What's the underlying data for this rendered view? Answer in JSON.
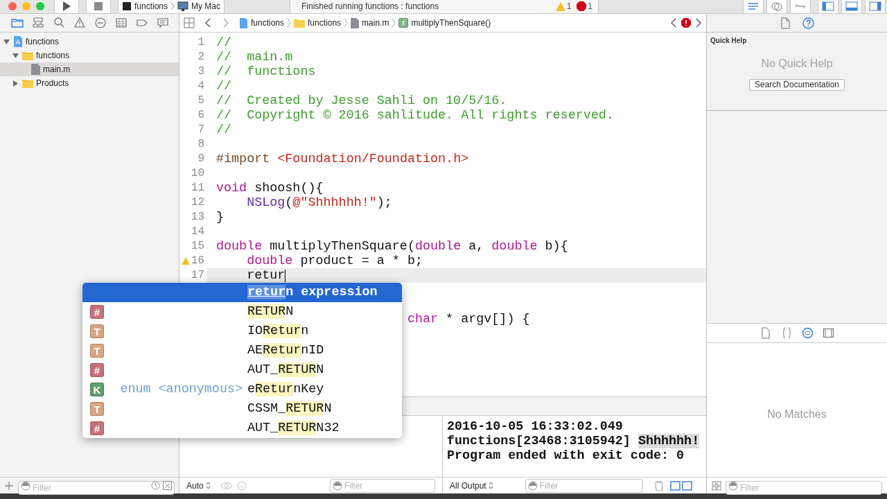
{
  "toolbar": {
    "scheme": "functions",
    "destination": "My Mac",
    "status": "Finished running functions : functions",
    "warning_count": "1",
    "error_count": "1"
  },
  "navigator": {
    "tabs": [
      {
        "selected": true
      },
      {
        "selected": false
      },
      {
        "selected": false
      },
      {
        "selected": false
      },
      {
        "selected": false
      },
      {
        "selected": false
      },
      {
        "selected": false
      },
      {
        "selected": false
      }
    ],
    "tree": [
      {
        "kind": "project",
        "label": "functions",
        "expanded": true,
        "selected": false,
        "children": [
          {
            "kind": "folder",
            "label": "functions",
            "expanded": true,
            "selected": false,
            "children": [
              {
                "kind": "file",
                "label": "main.m",
                "selected": true
              }
            ]
          },
          {
            "kind": "folder",
            "label": "Products",
            "expanded": false,
            "selected": false
          }
        ]
      }
    ],
    "filter": {
      "placeholder": "Filter"
    }
  },
  "jump_bar": {
    "crumbs": [
      {
        "kind": "project",
        "label": "functions"
      },
      {
        "kind": "folder",
        "label": "functions"
      },
      {
        "kind": "file",
        "label": "main.m"
      },
      {
        "kind": "function",
        "label": "multiplyThenSquare()"
      }
    ]
  },
  "editor": {
    "lines": [
      {
        "number": "1",
        "warning": false,
        "current": false,
        "tokens": [
          {
            "t": "//",
            "kind": "comment"
          }
        ]
      },
      {
        "number": "2",
        "warning": false,
        "current": false,
        "tokens": [
          {
            "t": "//  main.m",
            "kind": "comment"
          }
        ]
      },
      {
        "number": "3",
        "warning": false,
        "current": false,
        "tokens": [
          {
            "t": "//  functions",
            "kind": "comment"
          }
        ]
      },
      {
        "number": "4",
        "warning": false,
        "current": false,
        "tokens": [
          {
            "t": "//",
            "kind": "comment"
          }
        ]
      },
      {
        "number": "5",
        "warning": false,
        "current": false,
        "tokens": [
          {
            "t": "//  Created by Jesse Sahli on 10/5/16.",
            "kind": "comment"
          }
        ]
      },
      {
        "number": "6",
        "warning": false,
        "current": false,
        "tokens": [
          {
            "t": "//  Copyright © 2016 sahlitude. All rights reserved.",
            "kind": "comment"
          }
        ]
      },
      {
        "number": "7",
        "warning": false,
        "current": false,
        "tokens": [
          {
            "t": "//",
            "kind": "comment"
          }
        ]
      },
      {
        "number": "8",
        "warning": false,
        "current": false
      },
      {
        "number": "9",
        "warning": false,
        "current": false,
        "tokens": [
          {
            "t": "#import",
            "kind": "preprocessor"
          },
          {
            "t": " <Foundation/Foundation.h>",
            "kind": "string"
          }
        ]
      },
      {
        "number": "10",
        "warning": false,
        "current": false
      },
      {
        "number": "11",
        "warning": false,
        "current": false,
        "tokens": [
          {
            "t": "void",
            "kind": "keyword"
          },
          {
            "t": " shoosh(){",
            "kind": "plain"
          }
        ]
      },
      {
        "number": "12",
        "warning": false,
        "current": false,
        "tokens": [
          {
            "t": "    NSLog",
            "kind": "function"
          },
          {
            "t": "(",
            "kind": "plain"
          },
          {
            "t": "@\"Shhhhhh!\"",
            "kind": "string"
          },
          {
            "t": ");",
            "kind": "plain"
          }
        ]
      },
      {
        "number": "13",
        "warning": false,
        "current": false,
        "tokens": [
          {
            "t": "}",
            "kind": "plain"
          }
        ]
      },
      {
        "number": "14",
        "warning": false,
        "current": false
      },
      {
        "number": "15",
        "warning": false,
        "current": false,
        "tokens": [
          {
            "t": "double",
            "kind": "keyword"
          },
          {
            "t": " multiplyThenSquare(",
            "kind": "plain"
          },
          {
            "t": "double",
            "kind": "keyword"
          },
          {
            "t": " a, ",
            "kind": "plain"
          },
          {
            "t": "double",
            "kind": "keyword"
          },
          {
            "t": " b){",
            "kind": "plain"
          }
        ]
      },
      {
        "number": "16",
        "warning": true,
        "current": false,
        "tokens": [
          {
            "t": "    double",
            "kind": "keyword"
          },
          {
            "t": " product = a * b;",
            "kind": "plain"
          }
        ]
      },
      {
        "number": "17",
        "warning": false,
        "current": true,
        "tokens": [
          {
            "t": "    retur",
            "kind": "plain"
          }
        ]
      },
      {
        "warning": false,
        "current": false
      },
      {
        "warning": false,
        "current": false
      },
      {
        "warning": false,
        "current": false,
        "tokens": [
          {
            "t": "                         char",
            "kind": "keyword"
          },
          {
            "t": " * argv[]) {",
            "kind": "plain"
          }
        ]
      }
    ]
  },
  "completion": {
    "items": [
      {
        "selected": true,
        "match": "retur",
        "suffix": "n expression"
      },
      {
        "selected": false,
        "badge": "#",
        "color": "#c8707b",
        "match": "RETUR",
        "suffix": "N"
      },
      {
        "selected": false,
        "badge": "T",
        "color": "#d8a682",
        "prefix": "IO",
        "match": "Retur",
        "suffix": "n"
      },
      {
        "selected": false,
        "badge": "T",
        "color": "#d8a682",
        "prefix": "AE",
        "match": "Retur",
        "suffix": "nID"
      },
      {
        "selected": false,
        "badge": "#",
        "color": "#c8707b",
        "prefix": "AUT_",
        "match": "RETUR",
        "suffix": "N"
      },
      {
        "selected": false,
        "badge": "K",
        "color": "#5f9f69",
        "type": "enum <anonymous>",
        "prefix": "e",
        "match": "Retur",
        "suffix": "nKey"
      },
      {
        "selected": false,
        "badge": "T",
        "color": "#d8a682",
        "prefix": "CSSM_",
        "match": "RETUR",
        "suffix": "N"
      },
      {
        "selected": false,
        "badge": "#",
        "color": "#c8707b",
        "prefix": "AUT_",
        "match": "RETUR",
        "suffix": "N32"
      }
    ]
  },
  "debug": {
    "variables_scope": "Auto",
    "variables_filter": {
      "placeholder": "Filter"
    },
    "console": [
      {
        "segments": [
          {
            "text": "2016-10-05 16:33:02.049",
            "highlight": false
          }
        ]
      },
      {
        "segments": [
          {
            "text": "functions[23468:3105942] ",
            "highlight": false
          },
          {
            "text": "Shhhhhh!",
            "highlight": true
          }
        ]
      },
      {
        "segments": [
          {
            "text": "Program ended with exit code: 0",
            "highlight": false
          }
        ]
      }
    ],
    "output_mode": "All Output",
    "console_filter": {
      "placeholder": "Filter"
    }
  },
  "inspector": {
    "tabs": [
      {
        "selected": false
      },
      {
        "selected": true
      }
    ],
    "title": "Quick Help",
    "empty_message": "No Quick Help",
    "search_button": "Search Documentation",
    "library_tabs": [
      {
        "selected": false
      },
      {
        "selected": false
      },
      {
        "selected": true
      },
      {
        "selected": false
      }
    ],
    "library_empty": "No Matches",
    "filter": {
      "placeholder": "Filter"
    }
  }
}
